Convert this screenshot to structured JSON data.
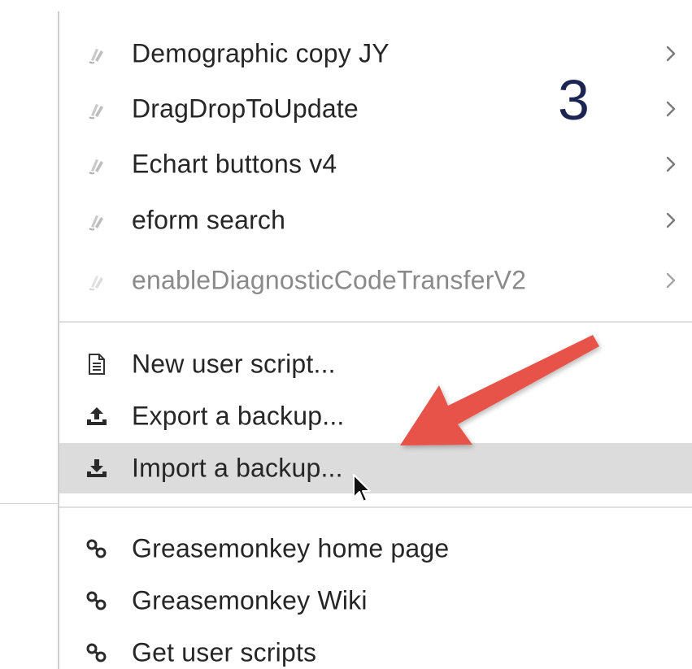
{
  "menu": {
    "scripts": [
      {
        "label": "Demographic copy JY",
        "enabled": true,
        "icon": "monkey-icon"
      },
      {
        "label": "DragDropToUpdate",
        "enabled": true,
        "icon": "monkey-icon"
      },
      {
        "label": "Echart buttons v4",
        "enabled": true,
        "icon": "monkey-icon"
      },
      {
        "label": "eform search",
        "enabled": true,
        "icon": "monkey-icon"
      },
      {
        "label": "enableDiagnosticCodeTransferV2",
        "enabled": false,
        "icon": "monkey-icon"
      }
    ],
    "actions": [
      {
        "label": "New user script...",
        "icon": "document-icon"
      },
      {
        "label": "Export a backup...",
        "icon": "upload-icon"
      },
      {
        "label": "Import a backup...",
        "icon": "download-icon",
        "highlighted": true
      }
    ],
    "links": [
      {
        "label": "Greasemonkey home page",
        "icon": "link-icon"
      },
      {
        "label": "Greasemonkey Wiki",
        "icon": "link-icon"
      },
      {
        "label": "Get user scripts",
        "icon": "link-icon"
      }
    ]
  },
  "annotation": {
    "step_number": "3",
    "arrow_color": "#e8534a",
    "step_color": "#1c2552"
  },
  "colors": {
    "highlight": "#dcdcdc",
    "text": "#262626",
    "disabled_text": "#8a8a8a"
  }
}
